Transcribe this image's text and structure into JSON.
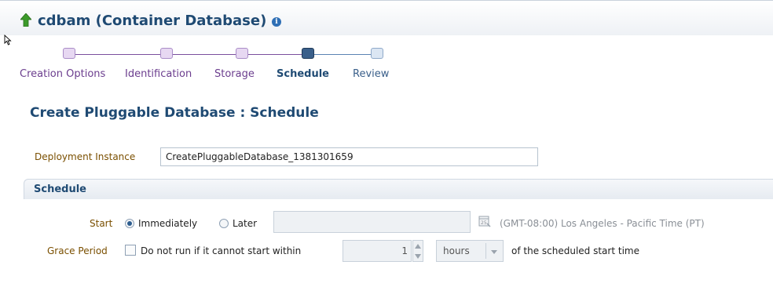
{
  "header": {
    "title": "cdbam (Container Database)",
    "up_icon": "green-up-arrow-icon",
    "info_icon": "info-icon"
  },
  "train": {
    "steps": [
      {
        "label": "Creation Options",
        "state": "visited"
      },
      {
        "label": "Identification",
        "state": "visited"
      },
      {
        "label": "Storage",
        "state": "visited"
      },
      {
        "label": "Schedule",
        "state": "current"
      },
      {
        "label": "Review",
        "state": "next"
      }
    ]
  },
  "page": {
    "heading": "Create Pluggable Database : Schedule"
  },
  "deployment": {
    "label": "Deployment Instance",
    "value": "CreatePluggableDatabase_1381301659"
  },
  "schedule": {
    "section_title": "Schedule",
    "start_label": "Start",
    "immediately_label": "Immediately",
    "later_label": "Later",
    "selected": "Immediately",
    "later_value": "",
    "timezone": "(GMT-08:00) Los Angeles - Pacific Time (PT)",
    "grace_label": "Grace Period",
    "grace_checkbox_label": "Do not run if it cannot start within",
    "grace_checked": false,
    "grace_value": "1",
    "unit_value": "hours",
    "suffix": "of the scheduled start time"
  },
  "colors": {
    "title": "#1f4a73",
    "visited_step": "#6b3d8e",
    "current_node": "#3a5f8a",
    "label_brown": "#7a4f00"
  }
}
